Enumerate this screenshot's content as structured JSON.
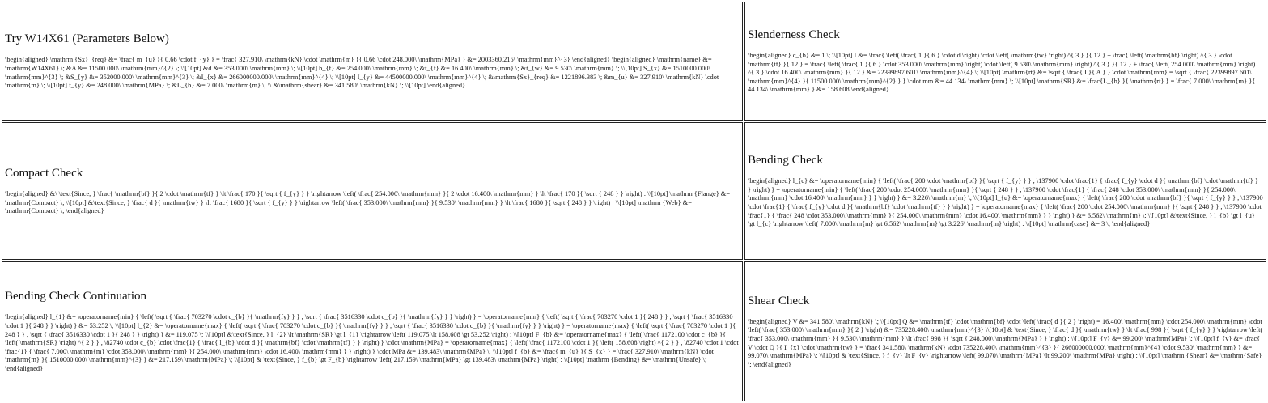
{
  "cells": [
    {
      "title": "Try W14X61 (Parameters Below)",
      "latex": "\\begin{aligned} \\mathrm {Sx}_{req} &= \\frac{ m_{u} }{ 0.66 \\cdot f_{y} } = \\frac{ 327.910\\ \\mathrm{kN} \\cdot \\mathrm{m} }{ 0.66 \\cdot 248.000\\ \\mathrm{MPa} } &= 2003360.215\\ \\mathrm{mm}^{3} \\end{aligned} \\begin{aligned} \\mathrm{name} &= \\mathrm{W14X61} \\; &A &= 11500.000\\ \\mathrm{mm}^{2} \\; \\\\[10pt] &d &= 353.000\\ \\mathrm{mm} \\; \\\\[10pt] b_{f} &= 254.000\\ \\mathrm{mm} \\; &t_{f} &= 16.400\\ \\mathrm{mm} \\; &t_{w} &= 9.530\\ \\mathrm{mm} \\; \\\\[10pt] S_{x} &= 1510000.000\\ \\mathrm{mm}^{3} \\; &S_{y} &= 352000.000\\ \\mathrm{mm}^{3} \\; &I_{x} &= 266000000.000\\ \\mathrm{mm}^{4} \\; \\\\[10pt] I_{y} &= 44500000.000\\ \\mathrm{mm}^{4} \\; &\\mathrm{Sx}_{req} &= 1221896.383 \\; &m_{u} &= 327.910\\ \\mathrm{kN} \\cdot \\mathrm{m} \\; \\\\[10pt] f_{y} &= 248.000\\ \\mathrm{MPa} \\; &L_{b} &= 7.000\\ \\mathrm{m} \\; \\\\ &\\mathrm{shear} &= 341.580\\ \\mathrm{kN} \\; \\\\[10pt] \\end{aligned}"
    },
    {
      "title": "Slenderness Check",
      "latex": "\\begin{aligned} c_{b} &= 1 \\; \\\\[10pt] I &= \\frac{ \\left( \\frac{ 1 }{ 6 } \\cdot d \\right) \\cdot \\left( \\mathrm{tw} \\right) ^{ 3 } }{ 12 } + \\frac{ \\left( \\mathrm{bf} \\right) ^{ 3 } \\cdot \\mathrm{tf} }{ 12 } = \\frac{ \\left( \\frac{ 1 }{ 6 } \\cdot 353.000\\ \\mathrm{mm} \\right) \\cdot \\left( 9.530\\ \\mathrm{mm} \\right) ^{ 3 } }{ 12 } + \\frac{ \\left( 254.000\\ \\mathrm{mm} \\right) ^{ 3 } \\cdot 16.400\\ \\mathrm{mm} }{ 12 } &= 22399897.601\\ \\mathrm{mm}^{4} \\; \\\\[10pt] \\mathrm{rt} &= \\sqrt { \\frac{ I }{ A } } \\cdot \\mathrm{mm} = \\sqrt { \\frac{ 22399897.601\\ \\mathrm{mm}^{4} }{ 11500.000\\ \\mathrm{mm}^{2} } } \\cdot mm &= 44.134\\ \\mathrm{mm} \\; \\\\[10pt] \\mathrm{SR} &= \\frac{L_{b} }{ \\mathrm{rt} } = \\frac{ 7.000\\ \\mathrm{m} }{ 44.134\\ \\mathrm{mm} } &= 158.608 \\end{aligned}"
    },
    {
      "title": "Compact Check",
      "latex": "\\begin{aligned} &\\ \\text{Since, } \\frac{ \\mathrm{bf} }{ 2 \\cdot \\mathrm{tf} } \\lt \\frac{ 170 }{ \\sqrt { f_{y} } } \\rightarrow \\left( \\frac{ 254.000\\ \\mathrm{mm} }{ 2 \\cdot 16.400\\ \\mathrm{mm} } \\lt \\frac{ 170 }{ \\sqrt { 248 } } \\right) : \\\\[10pt] \\mathrm {Flange} &= \\mathrm{Compact} \\; \\\\[10pt] &\\text{Since, } \\frac{ d }{ \\mathrm{tw} } \\lt \\frac{ 1680 }{ \\sqrt { f_{y} } } \\rightarrow \\left( \\frac{ 353.000\\ \\mathrm{mm} }{ 9.530\\ \\mathrm{mm} } \\lt \\frac{ 1680 }{ \\sqrt { 248 } } \\right) : \\\\[10pt] \\mathrm {Web} &= \\mathrm{Compact} \\; \\end{aligned}"
    },
    {
      "title": "Bending Check",
      "latex": "\\begin{aligned} l_{c} &= \\operatorname{min} { \\left( \\frac{ 200 \\cdot \\mathrm{bf} }{ \\sqrt { f_{y} } } , \\137900 \\cdot \\frac{1} { \\frac{ f_{y} \\cdot d }{ \\mathrm{bf} \\cdot \\mathrm{tf} } } \\right) } = \\operatorname{min} { \\left( \\frac{ 200 \\cdot 254.000\\ \\mathrm{mm} }{ \\sqrt { 248 } } , \\137900 \\cdot \\frac{1} { \\frac{ 248 \\cdot 353.000\\ \\mathrm{mm} }{ 254.000\\ \\mathrm{mm} \\cdot 16.400\\ \\mathrm{mm} } } \\right) } &= 3.226\\ \\mathrm{m} \\; \\\\[10pt] l_{u} &= \\operatorname{max} { \\left( \\frac{ 200 \\cdot \\mathrm{bf} }{ \\sqrt { f_{y} } } , \\137900 \\cdot \\frac{1} { \\frac{ f_{y} \\cdot d }{ \\mathrm{bf} \\cdot \\mathrm{tf} } } \\right) } = \\operatorname{max} { \\left( \\frac{ 200 \\cdot 254.000\\ \\mathrm{mm} }{ \\sqrt { 248 } } , \\137900 \\cdot \\frac{1} { \\frac{ 248 \\cdot 353.000\\ \\mathrm{mm} }{ 254.000\\ \\mathrm{mm} \\cdot 16.400\\ \\mathrm{mm} } } \\right) } &= 6.562\\ \\mathrm{m} \\; \\\\[10pt] &\\text{Since, } l_{b} \\gt l_{u} \\gt l_{c} \\rightarrow \\left( 7.000\\ \\mathrm{m} \\gt 6.562\\ \\mathrm{m} \\gt 3.226\\ \\mathrm{m} \\right) : \\\\[10pt] \\mathrm{case} &= 3 \\; \\end{aligned}"
    },
    {
      "title": "Bending Check Continuation",
      "latex": "\\begin{aligned} l_{1} &= \\operatorname{min} { \\left( \\sqrt { \\frac{ 703270 \\cdot c_{b} }{ \\mathrm{fy} } } , \\sqrt { \\frac{ 3516330 \\cdot c_{b} }{ \\mathrm{fy} } } \\right) } = \\operatorname{min} { \\left( \\sqrt { \\frac{ 703270 \\cdot 1 }{ 248 } } , \\sqrt { \\frac{ 3516330 \\cdot 1 }{ 248 } } \\right) } &= 53.252 \\; \\\\[10pt] l_{2} &= \\operatorname{max} { \\left( \\sqrt { \\frac{ 703270 \\cdot c_{b} }{ \\mathrm{fy} } } , \\sqrt { \\frac{ 3516330 \\cdot c_{b} }{ \\mathrm{fy} } } \\right) } = \\operatorname{max} { \\left( \\sqrt { \\frac{ 703270 \\cdot 1 }{ 248 } } , \\sqrt { \\frac{ 3516330 \\cdot 1 }{ 248 } } \\right) } &= 119.075 \\; \\\\[10pt] &\\text{Since, } l_{2} \\lt \\mathrm{SR} \\gt l_{1} \\rightarrow \\left( 119.075 \\lt 158.608 \\gt 53.252 \\right) : \\\\[10pt] F_{b} &= \\operatorname{max} { \\left( \\frac{ 1172100 \\cdot c_{b} }{ \\left( \\mathrm{SR} \\right) ^{ 2 } } , \\82740 \\cdot c_{b} \\cdot \\frac{1} { \\frac{ l_{b} \\cdot d }{ \\mathrm{bf} \\cdot \\mathrm{tf} } } \\right) } \\cdot \\mathrm{MPa} = \\operatorname{max} { \\left( \\frac{ 1172100 \\cdot 1 }{ \\left( 158.608 \\right) ^{ 2 } } , \\82740 \\cdot 1 \\cdot \\frac{1} { \\frac{ 7.000\\ \\mathrm{m} \\cdot 353.000\\ \\mathrm{mm} }{ 254.000\\ \\mathrm{mm} \\cdot 16.400\\ \\mathrm{mm} } } \\right) } \\cdot MPa &= 139.483\\ \\mathrm{MPa} \\; \\\\[10pt] f_{b} &= \\frac{ m_{u} }{ S_{x} } = \\frac{ 327.910\\ \\mathrm{kN} \\cdot \\mathrm{m} }{ 1510000.000\\ \\mathrm{mm}^{3} } &= 217.159\\ \\mathrm{MPa} \\; \\\\[10pt] & \\text{Since, } f_{b} \\gt F_{b} \\rightarrow \\left( 217.159\\ \\mathrm{MPa} \\gt 139.483\\ \\mathrm{MPa} \\right) : \\\\[10pt] \\mathrm {Bending} &= \\mathrm{Unsafe} \\; \\end{aligned}"
    },
    {
      "title": "Shear Check",
      "latex": "\\begin{aligned} V &= 341.580\\ \\mathrm{kN} \\; \\\\[10pt] Q &= \\mathrm{tf} \\cdot \\mathrm{bf} \\cdot \\left( \\frac{ d }{ 2 } \\right) = 16.400\\ \\mathrm{mm} \\cdot 254.000\\ \\mathrm{mm} \\cdot \\left( \\frac{ 353.000\\ \\mathrm{mm} }{ 2 } \\right) &= 735228.400\\ \\mathrm{mm}^{3} \\\\[10pt] & \\text{Since, } \\frac{ d }{ \\mathrm{tw} } \\lt \\frac{ 998 }{ \\sqrt { f_{y} } } \\rightarrow \\left( \\frac{ 353.000\\ \\mathrm{mm} }{ 9.530\\ \\mathrm{mm} } \\lt \\frac{ 998 }{ \\sqrt { 248.000\\ \\mathrm{MPa} } } \\right) : \\\\[10pt] F_{v} &= 99.200\\ \\mathrm{MPa} \\; \\\\[10pt] f_{v} &= \\frac{ V \\cdot Q }{ I_{x} \\cdot \\mathrm{tw} } = \\frac{ 341.580\\ \\mathrm{kN} \\cdot 735228.400\\ \\mathrm{mm}^{3} }{ 266000000.000\\ \\mathrm{mm}^{4} \\cdot 9.530\\ \\mathrm{mm} } &= 99.070\\ \\mathrm{MPa} \\; \\\\[10pt] & \\text{Since, } f_{v} \\lt F_{v} \\rightarrow \\left( 99.070\\ \\mathrm{MPa} \\lt 99.200\\ \\mathrm{MPa} \\right) : \\\\[10pt] \\mathrm {Shear} &= \\mathrm{Safe} \\; \\end{aligned}"
    }
  ]
}
